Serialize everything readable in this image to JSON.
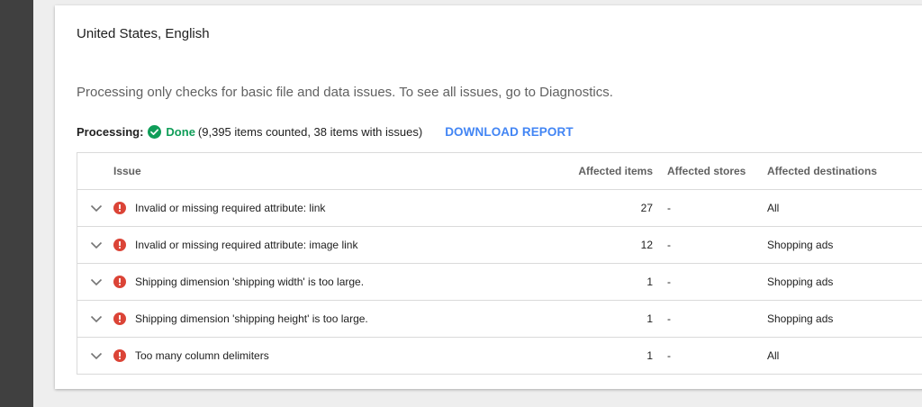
{
  "feed": {
    "title": "United States, English",
    "info": "Processing only checks for basic file and data issues. To see all issues, go to Diagnostics."
  },
  "processing": {
    "label": "Processing:",
    "status": "Done",
    "summary": "(9,395 items counted, 38 items with issues)",
    "download_label": "DOWNLOAD REPORT"
  },
  "table": {
    "headers": {
      "issue": "Issue",
      "affected_items": "Affected items",
      "affected_stores": "Affected stores",
      "affected_destinations": "Affected destinations"
    },
    "rows": [
      {
        "issue": "Invalid or missing required attribute: link",
        "items": "27",
        "stores": "-",
        "destinations": "All"
      },
      {
        "issue": "Invalid or missing required attribute: image link",
        "items": "12",
        "stores": "-",
        "destinations": "Shopping ads"
      },
      {
        "issue": "Shipping dimension 'shipping width' is too large.",
        "items": "1",
        "stores": "-",
        "destinations": "Shopping ads"
      },
      {
        "issue": "Shipping dimension 'shipping height' is too large.",
        "items": "1",
        "stores": "-",
        "destinations": "Shopping ads"
      },
      {
        "issue": "Too many column delimiters",
        "items": "1",
        "stores": "-",
        "destinations": "All"
      }
    ]
  },
  "icons": {
    "status": "check-circle-icon",
    "row_expand": "chevron-down-icon",
    "row_severity": "error-icon"
  },
  "colors": {
    "done_green": "#0f9d58",
    "error_red": "#db4437",
    "link_blue": "#4285f4"
  }
}
